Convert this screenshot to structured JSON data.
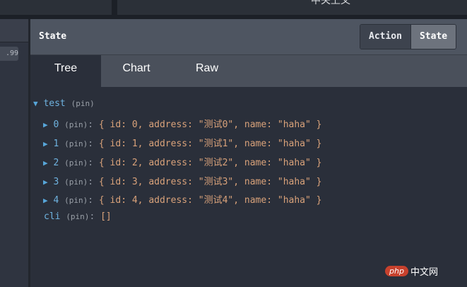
{
  "window": {
    "title": "中关上文"
  },
  "left_pane": {
    "value_badge": ".99"
  },
  "panel": {
    "title": "State",
    "buttons": {
      "action": "Action",
      "state": "State"
    }
  },
  "tabs": [
    {
      "label": "Tree",
      "active": true
    },
    {
      "label": "Chart",
      "active": false
    },
    {
      "label": "Raw",
      "active": false
    }
  ],
  "tree": {
    "root": {
      "arrow": "▼",
      "key": "test",
      "pin": "(pin)"
    },
    "items": [
      {
        "arrow": "▶",
        "key": "0",
        "pin": "(pin)",
        "colon": ":",
        "value": "{ id: 0, address: \"测试0\", name: \"haha\" }"
      },
      {
        "arrow": "▶",
        "key": "1",
        "pin": "(pin)",
        "colon": ":",
        "value": "{ id: 1, address: \"测试1\", name: \"haha\" }"
      },
      {
        "arrow": "▶",
        "key": "2",
        "pin": "(pin)",
        "colon": ":",
        "value": "{ id: 2, address: \"测试2\", name: \"haha\" }"
      },
      {
        "arrow": "▶",
        "key": "3",
        "pin": "(pin)",
        "colon": ":",
        "value": "{ id: 3, address: \"测试3\", name: \"haha\" }"
      },
      {
        "arrow": "▶",
        "key": "4",
        "pin": "(pin)",
        "colon": ":",
        "value": "{ id: 4, address: \"测试4\", name: \"haha\" }"
      }
    ],
    "cli": {
      "key": "cli",
      "pin": "(pin)",
      "colon": ":",
      "value": "[]"
    }
  },
  "watermark": {
    "badge": "php",
    "text": "中文网"
  },
  "colors": {
    "key": "#6fb3e0",
    "value": "#d9a27a",
    "arrow": "#57a6d9",
    "header": "#4e5561",
    "background": "#2a2f3a"
  },
  "icons": {
    "expanded": "triangle-down-icon",
    "collapsed": "triangle-right-icon"
  }
}
